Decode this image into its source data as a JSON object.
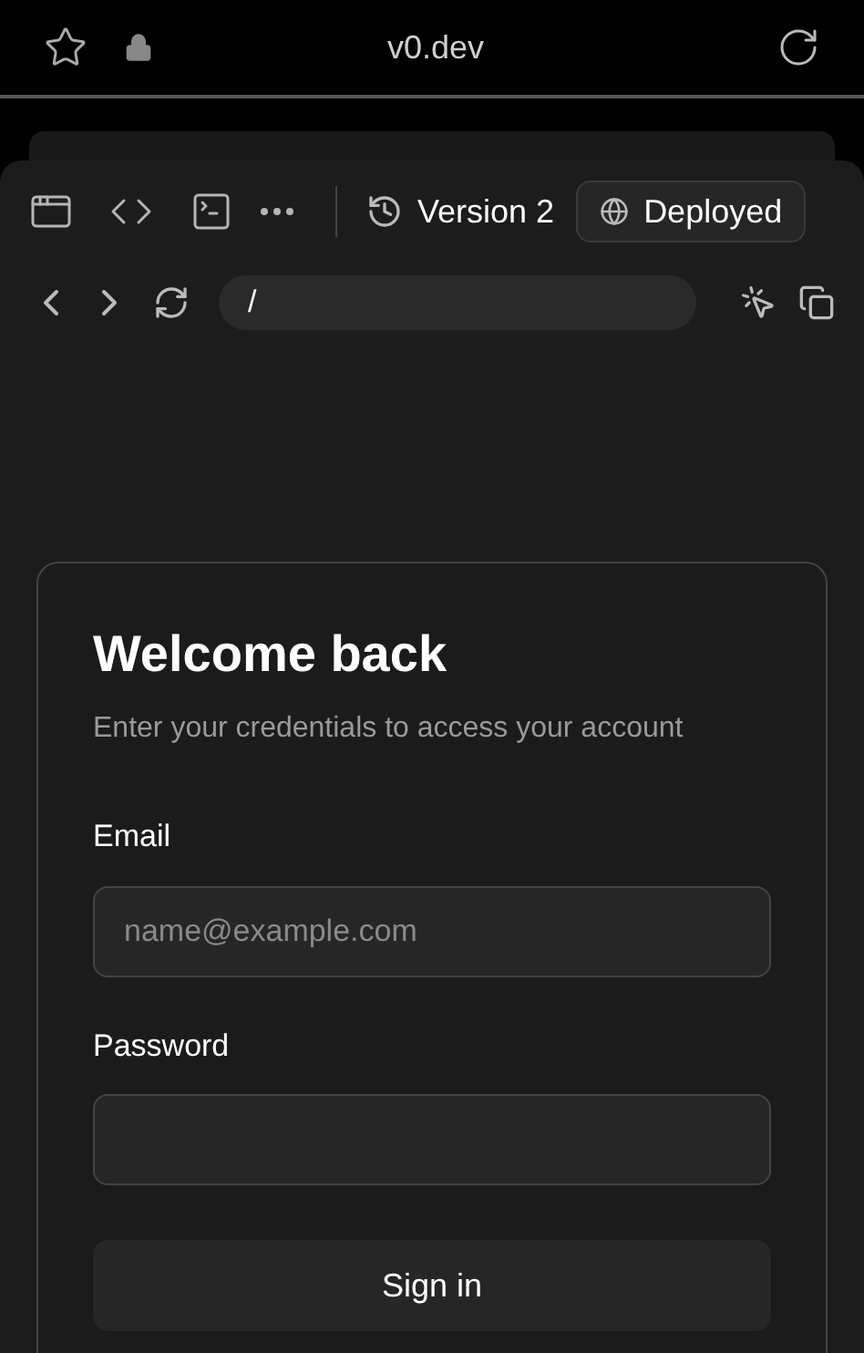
{
  "browser": {
    "url": "v0.dev"
  },
  "toolbar": {
    "version": "Version 2",
    "status": "Deployed"
  },
  "preview_nav": {
    "path": "/"
  },
  "login_card": {
    "title": "Welcome back",
    "subtitle": "Enter your credentials to access your account",
    "fields": [
      {
        "label": "Email",
        "placeholder": "name@example.com"
      },
      {
        "label": "Password"
      }
    ],
    "submit": "Sign in"
  }
}
